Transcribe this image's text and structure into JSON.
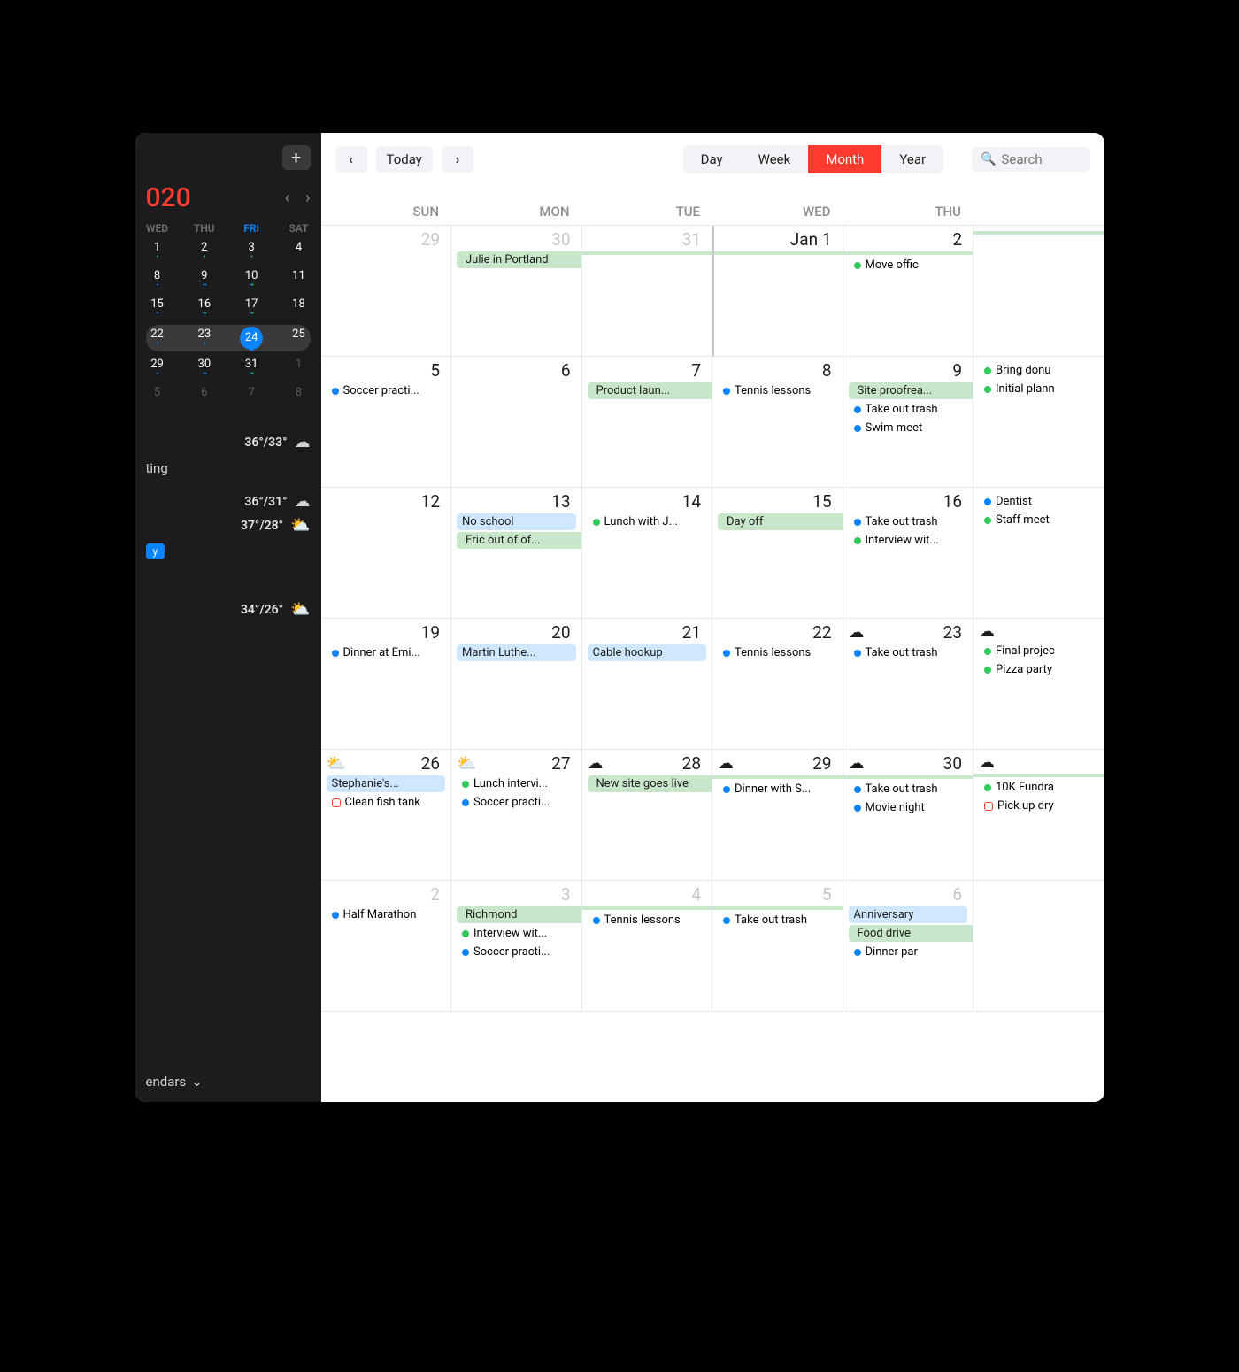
{
  "sidebar": {
    "year": "020",
    "mini_headers": [
      "WED",
      "THU",
      "FRI",
      "SAT"
    ],
    "mini_rows": [
      [
        {
          "n": "1",
          "d": "g"
        },
        {
          "n": "2",
          "d": "g"
        },
        {
          "n": "3",
          "d": "g"
        },
        {
          "n": "4",
          "d": ""
        }
      ],
      [
        {
          "n": "8",
          "d": "b"
        },
        {
          "n": "9",
          "d": "bb"
        },
        {
          "n": "10",
          "d": "bg"
        },
        {
          "n": "11",
          "d": ""
        }
      ],
      [
        {
          "n": "15",
          "d": "b"
        },
        {
          "n": "16",
          "d": "bg"
        },
        {
          "n": "17",
          "d": "bg"
        },
        {
          "n": "18",
          "d": ""
        }
      ],
      [
        {
          "n": "22",
          "d": "b"
        },
        {
          "n": "23",
          "d": "b"
        },
        {
          "n": "24",
          "d": "bb",
          "today": true
        },
        {
          "n": "25",
          "d": ""
        }
      ],
      [
        {
          "n": "29",
          "d": "b"
        },
        {
          "n": "30",
          "d": "bb"
        },
        {
          "n": "31",
          "d": "bg"
        },
        {
          "n": "1",
          "d": "",
          "dim": true
        }
      ],
      [
        {
          "n": "5",
          "d": "",
          "dim": true
        },
        {
          "n": "6",
          "d": "",
          "dim": true
        },
        {
          "n": "7",
          "d": "",
          "dim": true
        },
        {
          "n": "8",
          "d": "",
          "dim": true
        }
      ]
    ],
    "weather": [
      {
        "temps": "36°/33°",
        "icon": "rain"
      },
      {
        "temps": "36°/31°",
        "icon": "rain"
      },
      {
        "temps": "37°/28°",
        "icon": "partly"
      },
      {
        "temps": "34°/26°",
        "icon": "partly"
      }
    ],
    "item_label": "ting",
    "pill_label": "y",
    "footer_label": "endars"
  },
  "toolbar": {
    "today": "Today",
    "views": [
      "Day",
      "Week",
      "Month",
      "Year"
    ],
    "active_view": "Month",
    "search_placeholder": "Search"
  },
  "day_headers": [
    "SUN",
    "MON",
    "TUE",
    "WED",
    "THU",
    ""
  ],
  "weeks": [
    [
      {
        "num": "29",
        "dim": true,
        "events": []
      },
      {
        "num": "30",
        "dim": true,
        "events": [
          {
            "t": "band-green start",
            "label": "Julie in Portland"
          }
        ]
      },
      {
        "num": "31",
        "dim": true,
        "events": [
          {
            "t": "band-green",
            "label": ""
          }
        ]
      },
      {
        "num": "Jan 1",
        "jan1": true,
        "events": [
          {
            "t": "band-green",
            "label": ""
          }
        ]
      },
      {
        "num": "2",
        "events": [
          {
            "t": "band-green",
            "label": ""
          },
          {
            "t": "dot-green",
            "label": "Move offic"
          }
        ]
      },
      {
        "num": "",
        "events": [
          {
            "t": "band-green",
            "label": ""
          }
        ]
      }
    ],
    [
      {
        "num": "5",
        "events": [
          {
            "t": "dot-blue",
            "label": "Soccer practi..."
          }
        ]
      },
      {
        "num": "6",
        "events": []
      },
      {
        "num": "7",
        "events": [
          {
            "t": "band-green start",
            "label": "Product laun..."
          }
        ]
      },
      {
        "num": "8",
        "events": [
          {
            "t": "dot-blue",
            "label": "Tennis lessons"
          }
        ]
      },
      {
        "num": "9",
        "events": [
          {
            "t": "band-green start",
            "label": "Site proofrea..."
          },
          {
            "t": "dot-blue",
            "label": "Take out trash"
          },
          {
            "t": "dot-blue",
            "label": "Swim meet"
          }
        ]
      },
      {
        "num": "",
        "events": [
          {
            "t": "dot-green",
            "label": "Bring donu"
          },
          {
            "t": "dot-green",
            "label": "Initial plann"
          }
        ]
      }
    ],
    [
      {
        "num": "12",
        "events": []
      },
      {
        "num": "13",
        "events": [
          {
            "t": "band-blue",
            "label": "No school"
          },
          {
            "t": "band-green start",
            "label": "Eric out of of..."
          }
        ]
      },
      {
        "num": "14",
        "events": [
          {
            "t": "dot-green",
            "label": "Lunch with J..."
          }
        ]
      },
      {
        "num": "15",
        "events": [
          {
            "t": "band-green start",
            "label": "Day off"
          }
        ]
      },
      {
        "num": "16",
        "events": [
          {
            "t": "dot-blue",
            "label": "Take out trash"
          },
          {
            "t": "dot-green",
            "label": "Interview wit..."
          }
        ]
      },
      {
        "num": "",
        "events": [
          {
            "t": "dot-blue",
            "label": "Dentist"
          },
          {
            "t": "dot-green",
            "label": "Staff meet"
          }
        ]
      }
    ],
    [
      {
        "num": "19",
        "events": [
          {
            "t": "dot-blue",
            "label": "Dinner at Emi..."
          }
        ]
      },
      {
        "num": "20",
        "events": [
          {
            "t": "band-blue",
            "label": "Martin Luthe..."
          }
        ]
      },
      {
        "num": "21",
        "events": [
          {
            "t": "band-blue",
            "label": "Cable hookup"
          }
        ]
      },
      {
        "num": "22",
        "events": [
          {
            "t": "dot-blue",
            "label": "Tennis lessons"
          }
        ]
      },
      {
        "num": "23",
        "wicon": "rain",
        "events": [
          {
            "t": "dot-blue",
            "label": "Take out trash"
          }
        ]
      },
      {
        "num": "",
        "wicon": "today",
        "events": [
          {
            "t": "dot-green",
            "label": "Final projec"
          },
          {
            "t": "dot-green",
            "label": "Pizza party"
          }
        ]
      }
    ],
    [
      {
        "num": "26",
        "wicon": "partly",
        "events": [
          {
            "t": "band-blue",
            "label": "Stephanie's..."
          },
          {
            "t": "dot-red",
            "label": "Clean fish tank"
          }
        ]
      },
      {
        "num": "27",
        "wicon": "partly",
        "events": [
          {
            "t": "dot-green",
            "label": "Lunch intervi..."
          },
          {
            "t": "dot-blue",
            "label": "Soccer practi..."
          }
        ]
      },
      {
        "num": "28",
        "wicon": "cloud",
        "events": [
          {
            "t": "band-green start",
            "label": "New site goes live"
          }
        ]
      },
      {
        "num": "29",
        "wicon": "cloud",
        "events": [
          {
            "t": "band-green",
            "label": ""
          },
          {
            "t": "dot-blue",
            "label": "Dinner with S..."
          }
        ]
      },
      {
        "num": "30",
        "wicon": "cloud",
        "events": [
          {
            "t": "band-green",
            "label": ""
          },
          {
            "t": "dot-blue",
            "label": "Take out trash"
          },
          {
            "t": "dot-blue",
            "label": "Movie night"
          }
        ]
      },
      {
        "num": "",
        "wicon": "cloud",
        "events": [
          {
            "t": "band-green",
            "label": ""
          },
          {
            "t": "dot-green",
            "label": "10K Fundra"
          },
          {
            "t": "dot-red",
            "label": "Pick up dry"
          }
        ]
      }
    ],
    [
      {
        "num": "2",
        "dim": true,
        "events": [
          {
            "t": "dot-blue",
            "label": "Half Marathon"
          }
        ]
      },
      {
        "num": "3",
        "dim": true,
        "events": [
          {
            "t": "band-green start",
            "label": "Richmond"
          },
          {
            "t": "dot-green",
            "label": "Interview wit..."
          },
          {
            "t": "dot-blue",
            "label": "Soccer practi..."
          }
        ]
      },
      {
        "num": "4",
        "dim": true,
        "events": [
          {
            "t": "band-green",
            "label": ""
          },
          {
            "t": "dot-blue",
            "label": "Tennis lessons"
          }
        ]
      },
      {
        "num": "5",
        "dim": true,
        "events": [
          {
            "t": "band-green",
            "label": ""
          },
          {
            "t": "dot-blue",
            "label": "Take out trash"
          }
        ]
      },
      {
        "num": "6",
        "dim": true,
        "events": [
          {
            "t": "band-blue",
            "label": "Anniversary"
          },
          {
            "t": "band-green start",
            "label": "Food drive"
          },
          {
            "t": "dot-blue",
            "label": "Dinner par"
          }
        ]
      },
      {
        "num": "",
        "events": []
      }
    ]
  ]
}
